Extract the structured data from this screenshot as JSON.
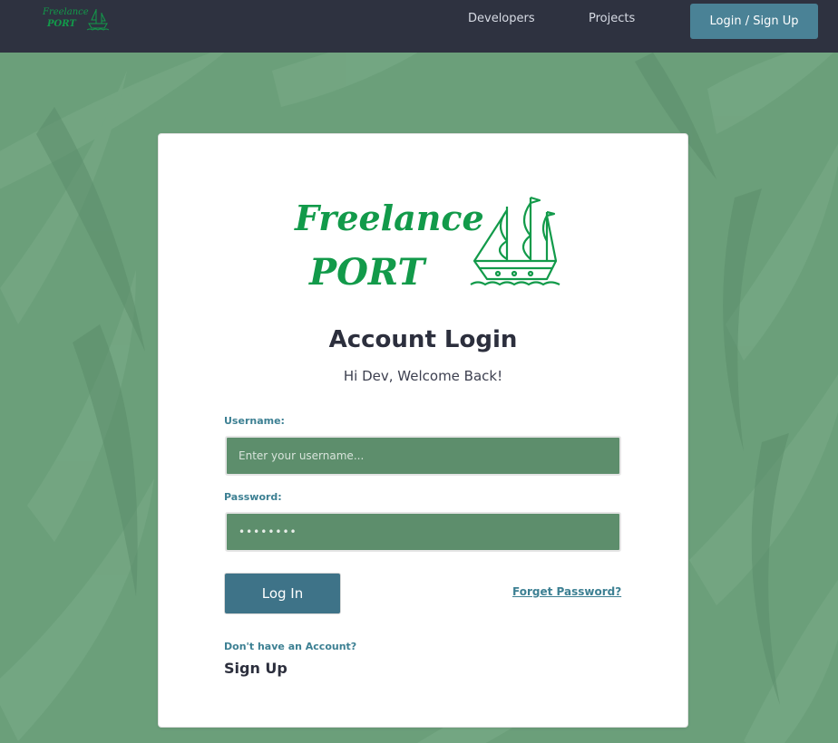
{
  "nav": {
    "logo_line1": "Freelance",
    "logo_line2": "PORT",
    "links": [
      "Developers",
      "Projects"
    ],
    "login_button": "Login / Sign Up"
  },
  "card": {
    "logo_line1": "Freelance",
    "logo_line2": "PORT",
    "title": "Account Login",
    "subtitle": "Hi Dev, Welcome Back!",
    "username_label": "Username:",
    "username_placeholder": "Enter your username...",
    "password_label": "Password:",
    "password_value": "••••••••",
    "login_button": "Log In",
    "forgot_link": "Forget Password?",
    "no_account_text": "Don't have an Account?",
    "signup_link": "Sign Up"
  },
  "colors": {
    "navbar": "#2e3240",
    "accent": "#4a8296",
    "brand_green": "#129a4a",
    "background": "#6b9f7a"
  }
}
